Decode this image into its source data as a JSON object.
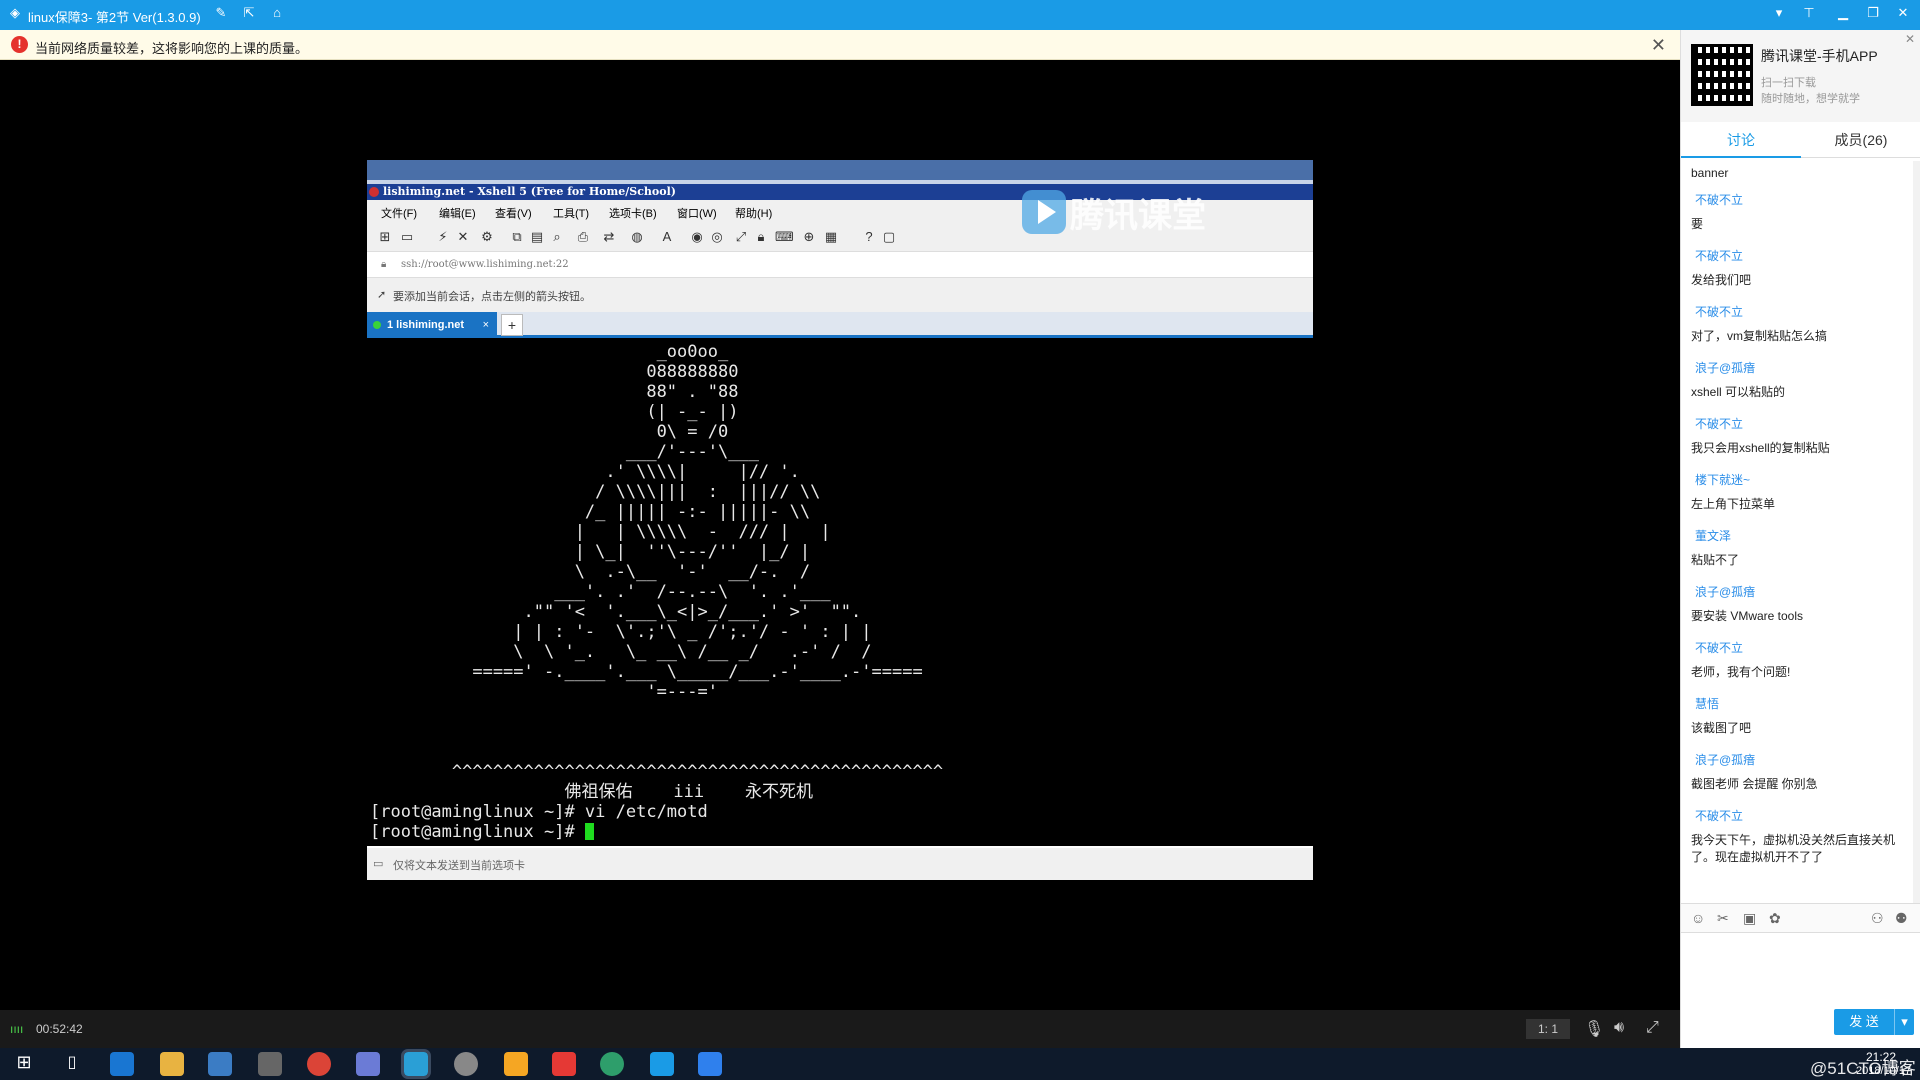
{
  "titlebar": {
    "title": "linux保障3- 第2节 Ver(1.3.0.9)",
    "icons": [
      "edit-icon",
      "share-icon",
      "home-icon"
    ],
    "window_buttons": [
      "dropdown-icon",
      "pin-icon",
      "minimize-icon",
      "restore-icon",
      "close-icon"
    ]
  },
  "warning": {
    "text": "当前网络质量较差，这将影响您的上课的质量。",
    "close": "✕"
  },
  "xshell": {
    "title": "lishiming.net - Xshell 5 (Free for Home/School)",
    "menu": [
      "文件(F)",
      "编辑(E)",
      "查看(V)",
      "工具(T)",
      "选项卡(B)",
      "窗口(W)",
      "帮助(H)"
    ],
    "address": "ssh://root@www.lishiming.net:22",
    "hint": "要添加当前会话，点击左侧的箭头按钮。",
    "tab_label": "1 lishiming.net",
    "tab_close": "×",
    "tab_add": "+",
    "compose_placeholder": "仅将文本发送到当前选项卡",
    "terminal_lines": [
      "                            _oo0oo_",
      "                           088888880",
      "                           88\" . \"88",
      "                           (| -_- |)",
      "                            0\\ = /0",
      "                         ___/'---'\\___",
      "                       .' \\\\\\\\|     |// '.",
      "                      / \\\\\\\\|||  :  |||// \\\\",
      "                     /_ ||||| -:- |||||- \\\\",
      "                    |   | \\\\\\\\\\  -  /// |   |",
      "                    | \\_|  ''\\---/''  |_/ |",
      "                    \\  .-\\__  '-'  __/-.  /",
      "                  ___'. .'  /--.--\\  '. .'___",
      "               .\"\" '<  '.___\\_<|>_/___.' >'  \"\".",
      "              | | : '-  \\'.;'\\ _ /';.'/ - ' : | |",
      "              \\  \\ '_.   \\_ __\\ /__ _/   .-' /  /",
      "          =====' -.____'.___ \\_____/___.-'____.-'=====",
      "                           '=---='",
      "",
      "",
      "        ^^^^^^^^^^^^^^^^^^^^^^^^^^^^^^^^^^^^^^^^^^^^^^^^",
      "                   佛祖保佑    iii    永不死机",
      "[root@aminglinux ~]# vi /etc/motd",
      "[root@aminglinux ~]# "
    ]
  },
  "watermark": "腾讯课堂",
  "video_bar": {
    "elapsed": "00:52:42",
    "ratio": "1: 1"
  },
  "panel": {
    "app_title": "腾讯课堂-手机APP",
    "app_sub1": "扫一扫下载",
    "app_sub2": "随时随地，想学就学",
    "tabs": [
      "讨论",
      "成员(26)"
    ],
    "send_label": "发 送",
    "messages": [
      {
        "user": "",
        "text": "banner"
      },
      {
        "user": "不破不立",
        "text": "要"
      },
      {
        "user": "不破不立",
        "text": "发给我们吧"
      },
      {
        "user": "不破不立",
        "text": "对了，vm复制粘贴怎么搞"
      },
      {
        "user": "浪子@孤瘖",
        "text": "xshell 可以粘贴的"
      },
      {
        "user": "不破不立",
        "text": "我只会用xshell的复制粘贴"
      },
      {
        "user": "楼下就迷~",
        "text": "左上角下拉菜单"
      },
      {
        "user": "董文泽",
        "text": "粘贴不了"
      },
      {
        "user": "浪子@孤瘖",
        "text": "要安装 VMware tools"
      },
      {
        "user": "不破不立",
        "text": "老师，我有个问题!"
      },
      {
        "user": "慧悟",
        "text": "该截图了吧"
      },
      {
        "user": "浪子@孤瘖",
        "text": "截图老师 会提醒 你别急"
      },
      {
        "user": "不破不立",
        "text": "我今天下午，虚拟机没关然后直接关机了。现在虚拟机开不了了"
      }
    ]
  },
  "taskbar": {
    "clock_time": "21:22",
    "clock_date": "2018/10/17",
    "watermark_text": "@51CTO博客"
  }
}
